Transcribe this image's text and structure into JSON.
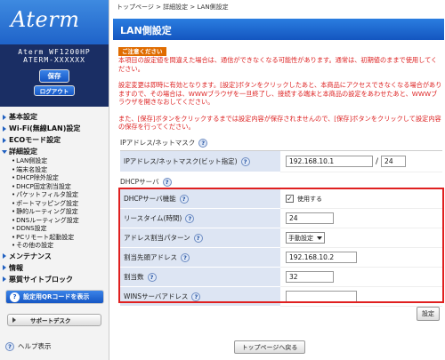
{
  "sidebar": {
    "logo": "Aterm",
    "model_line1": "Aterm WF1200HP",
    "model_line2": "ATERM-XXXXXX",
    "save_label": "保存",
    "logout_label": "ログアウト",
    "menu": [
      {
        "label": "基本設定",
        "subs": []
      },
      {
        "label": "Wi-Fi(無線LAN)設定",
        "subs": []
      },
      {
        "label": "ECOモード設定",
        "subs": []
      },
      {
        "label": "詳細設定",
        "subs": [
          "LAN側設定",
          "端末名設定",
          "DHCP除外設定",
          "DHCP固定割当設定",
          "パケットフィルタ設定",
          "ポートマッピング設定",
          "静的ルーティング設定",
          "DNSルーティング設定",
          "DDNS設定",
          "PCリモート起動設定",
          "その他の設定"
        ]
      },
      {
        "label": "メンテナンス",
        "subs": []
      },
      {
        "label": "情報",
        "subs": []
      },
      {
        "label": "悪質サイトブロック",
        "subs": []
      }
    ],
    "qr_label": "設定用QRコードを表示",
    "support_label": "サポートデスク",
    "help_label": "ヘルプ表示"
  },
  "main": {
    "breadcrumb": "トップページ > 詳細設定 > LAN側設定",
    "title": "LAN側設定",
    "notice_label": "ご注意ください",
    "notice1": "本項目の設定値を間違えた場合は、通信ができなくなる可能性があります。通常は、初期値のままで使用してください。",
    "notice2": "設定変更は即時に有効となります。[設定]ボタンをクリックしたあと、本商品にアクセスできなくなる場合がありますので、その場合は、WWWブラウザを一旦終了し、接続する端末と本商品の設定をあわせたあと、WWWブラウザを開きなおしてください。",
    "notice3": "また、[保存]ボタンをクリックするまでは設定内容が保存されませんので、[保存]ボタンをクリックして設定内容の保存を行ってください。",
    "ip_section": "IPアドレス/ネットマスク",
    "ip_label": "IPアドレス/ネットマスク(ビット指定)",
    "ip_value": "192.168.10.1",
    "ip_sep": "/",
    "mask_value": "24",
    "dhcp_section": "DHCPサーバ",
    "dhcp_rows": {
      "func_label": "DHCPサーバ機能",
      "func_check_label": "使用する",
      "lease_label": "リースタイム(時間)",
      "lease_value": "24",
      "pattern_label": "アドレス割当パターン",
      "pattern_value": "手動設定",
      "start_label": "割当先頭アドレス",
      "start_value": "192.168.10.2",
      "count_label": "割当数",
      "count_value": "32",
      "wins_label": "WINSサーバアドレス",
      "wins_value": ""
    },
    "config_label": "設定",
    "back_label": "トップページへ戻る",
    "help_glyph": "?"
  }
}
